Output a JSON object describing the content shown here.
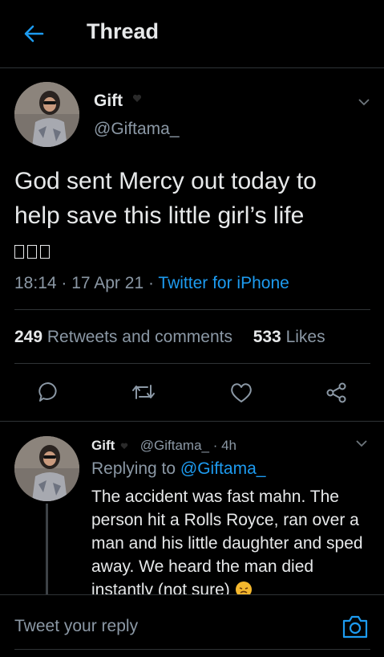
{
  "header": {
    "title": "Thread"
  },
  "main_tweet": {
    "author_name": "Gift",
    "author_handle": "@Giftama_",
    "text": "God sent Mercy out today to help save this little girl’s life",
    "timestamp": "18:14 · 17 Apr 21 · ",
    "source": "Twitter for iPhone",
    "retweets_count": "249",
    "retweets_label": "Retweets and comments",
    "likes_count": "533",
    "likes_label": "Likes"
  },
  "reply_tweet": {
    "author_name": "Gift",
    "author_handle": "@Giftama_ · 4h",
    "replying_prefix": "Replying to ",
    "replying_to": "@Giftama_",
    "text": "The accident was fast mahn. The person hit a Rolls Royce, ran over a man and his little daughter and sped away. We heard the man died instantly (not sure)"
  },
  "reply_bar": {
    "placeholder": "Tweet your reply"
  },
  "icons": {
    "back": "arrow-left-icon",
    "chevron": "chevron-down-icon",
    "reply": "comment-icon",
    "retweet": "retweet-icon",
    "like": "heart-icon",
    "share": "share-icon",
    "camera": "camera-icon"
  },
  "colors": {
    "accent": "#1d9bf0",
    "background": "#000000",
    "muted": "#8b98a5",
    "divider": "#2f3336"
  }
}
